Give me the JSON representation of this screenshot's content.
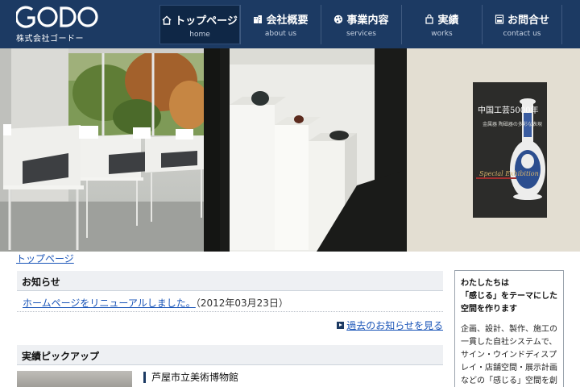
{
  "brand": {
    "logo_text": "GODO",
    "company_name": "株式会社ゴードー"
  },
  "nav": [
    {
      "label": "トップページ",
      "sub": "home",
      "icon": "home-icon",
      "active": true
    },
    {
      "label": "会社概要",
      "sub": "about us",
      "icon": "building-icon",
      "active": false
    },
    {
      "label": "事業内容",
      "sub": "services",
      "icon": "palette-icon",
      "active": false
    },
    {
      "label": "実績",
      "sub": "works",
      "icon": "bag-icon",
      "active": false
    },
    {
      "label": "お問合せ",
      "sub": "contact us",
      "icon": "mail-icon",
      "active": false
    }
  ],
  "hero": {
    "poster_title": "中国工芸5000年",
    "poster_subtitle": "金属器 陶磁器の多彩な表現",
    "poster_special": "Special Exhibition"
  },
  "breadcrumb": "トップページ",
  "news": {
    "heading": "お知らせ",
    "items": [
      {
        "link": "ホームページをリニューアルしました。",
        "date": "（2012年03月23日）"
      }
    ],
    "more_label": "過去のお知らせを見る"
  },
  "pickup": {
    "heading": "実績ピックアップ",
    "item_title": "芦屋市立美術博物館"
  },
  "sidebar": {
    "title_lines": [
      "わたしたちは",
      "「感じる」をテーマにした",
      "空間を作ります"
    ],
    "body_lines": [
      "企画、設計、製作、施工の",
      "一貫した自社システムで、",
      "サイン・ウインドディスプ",
      "レイ・店舗空間・展示計画",
      "などの「感じる」空間を創"
    ]
  },
  "colors": {
    "header_bg": "#1c3a63",
    "link": "#1a55b8"
  }
}
